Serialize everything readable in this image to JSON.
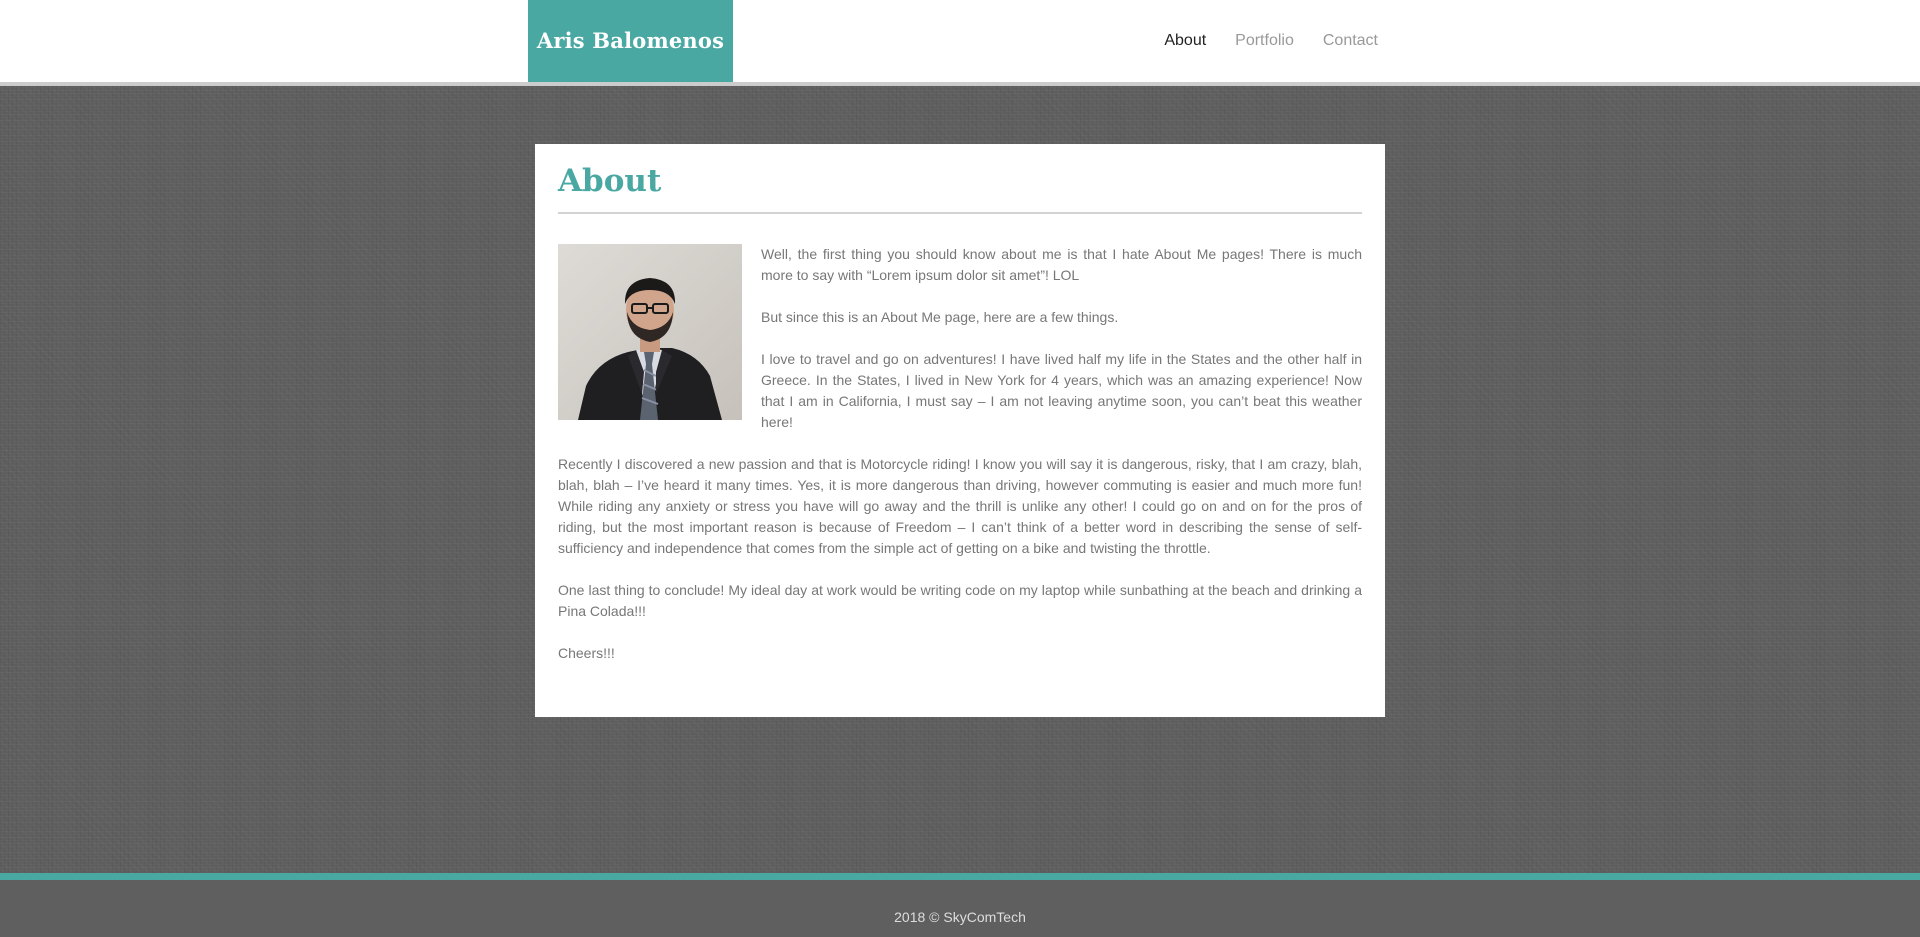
{
  "header": {
    "brand": "Aris Balomenos",
    "nav": [
      {
        "label": "About",
        "active": true
      },
      {
        "label": "Portfolio",
        "active": false
      },
      {
        "label": "Contact",
        "active": false
      }
    ]
  },
  "main": {
    "title": "About",
    "photo_icon": "portrait-photo",
    "paragraphs": [
      "Well, the first thing you should know about me is that I hate About Me pages! There is much more to say with “Lorem ipsum dolor sit amet”! LOL",
      "But since this is an About Me page, here are a few things.",
      "I love to travel and go on adventures! I have lived half my life in the States and the other half in Greece. In the States, I lived in New York for 4 years, which was an amazing experience! Now that I am in California, I must say – I am not leaving anytime soon, you can’t beat this weather here!",
      "Recently I discovered a new passion and that is Motorcycle riding! I know you will say it is dangerous, risky, that I am crazy, blah, blah, blah – I’ve heard it many times. Yes, it is more dangerous than driving, however commuting is easier and much more fun! While riding any anxiety or stress you have will go away and the thrill is unlike any other! I could go on and on for the pros of riding, but the most important reason is because of Freedom – I can’t think of a better word in describing the sense of self-sufficiency and independence that comes from the simple act of getting on a bike and twisting the throttle.",
      "One last thing to conclude! My ideal day at work would be writing code on my laptop while sunbathing at the beach and drinking a Pina Colada!!!",
      "Cheers!!!"
    ]
  },
  "footer": {
    "copyright": "2018 © SkyComTech"
  },
  "colors": {
    "accent": "#4aa8a3",
    "background": "#5e5e5e",
    "footer": "#5f5f5f"
  }
}
